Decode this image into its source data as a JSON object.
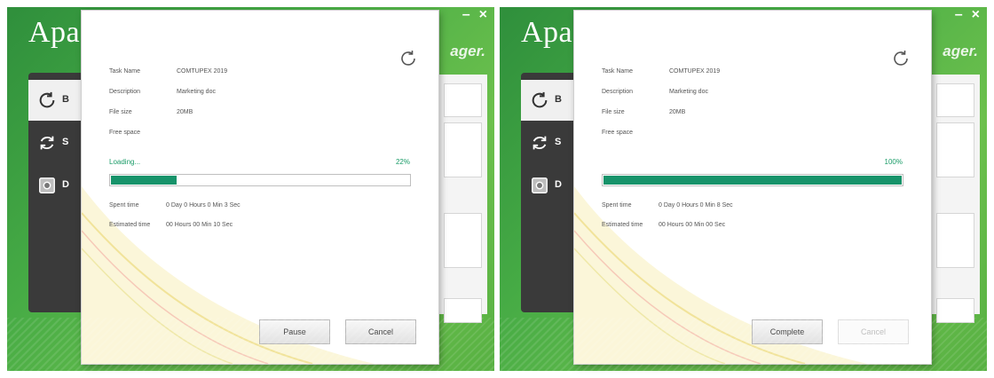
{
  "app": {
    "title": "Apac",
    "subtitle": "ager.",
    "window_controls": {
      "minimize": "–",
      "close": "×"
    },
    "sidebar": {
      "items": [
        {
          "label": "B",
          "icon": "refresh-icon"
        },
        {
          "label": "S",
          "icon": "sync-icon"
        },
        {
          "label": "D",
          "icon": "disk-icon"
        }
      ]
    }
  },
  "colors": {
    "accent_green": "#17936a",
    "app_green": "#46ab45",
    "sidebar_dark": "#3a3a3a"
  },
  "dialogs": [
    {
      "info": {
        "task_name_label": "Task Name",
        "task_name_value": "COMTUPEX 2019",
        "description_label": "Description",
        "description_value": "Marketing doc",
        "file_size_label": "File size",
        "file_size_value": "20MB",
        "free_space_label": "Free space",
        "free_space_value": ""
      },
      "status_label": "Loading...",
      "progress_percent_text": "22%",
      "progress_fraction": 0.22,
      "spent_time_label": "Spent time",
      "spent_time_value": "0 Day 0 Hours 0 Min 3 Sec",
      "estimated_time_label": "Estimated time",
      "estimated_time_value": "00 Hours 00 Min 10 Sec",
      "primary_button": "Pause",
      "secondary_button": "Cancel",
      "secondary_disabled": false
    },
    {
      "info": {
        "task_name_label": "Task Name",
        "task_name_value": "COMTUPEX 2019",
        "description_label": "Description",
        "description_value": "Marketing doc",
        "file_size_label": "File size",
        "file_size_value": "20MB",
        "free_space_label": "Free space",
        "free_space_value": ""
      },
      "status_label": "",
      "progress_percent_text": "100%",
      "progress_fraction": 1.0,
      "spent_time_label": "Spent time",
      "spent_time_value": "0 Day 0 Hours 0 Min 8 Sec",
      "estimated_time_label": "Estimated time",
      "estimated_time_value": "00 Hours 00 Min 00 Sec",
      "primary_button": "Complete",
      "secondary_button": "Cancel",
      "secondary_disabled": true
    }
  ]
}
